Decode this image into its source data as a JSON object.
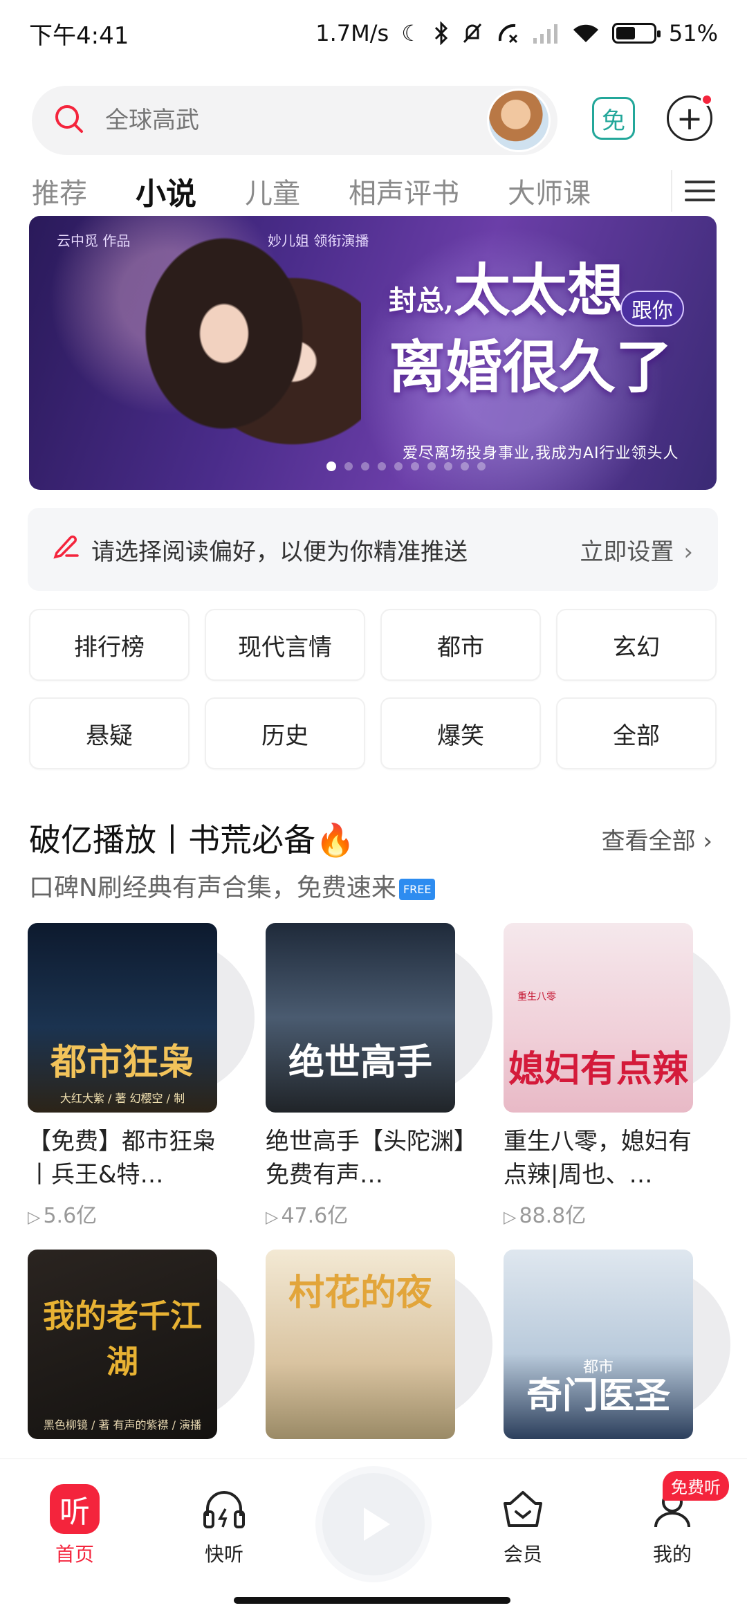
{
  "status": {
    "time": "下午4:41",
    "speed": "1.7M/s",
    "battery": "51%",
    "battery_level": 0.51
  },
  "search": {
    "placeholder": "全球高武"
  },
  "header": {
    "free_label": "免"
  },
  "tabs": [
    {
      "label": "推荐"
    },
    {
      "label": "小说"
    },
    {
      "label": "儿童"
    },
    {
      "label": "相声评书"
    },
    {
      "label": "大师课"
    }
  ],
  "banner": {
    "author": "云中觅 作品",
    "reader": "妙儿姐 领衔演播",
    "title_small": "封总,",
    "title_line1": "太太想",
    "title_line2": "离婚很久了",
    "badge": "跟你",
    "subtitle": "爱尽离场投身事业,我成为AI行业领头人"
  },
  "preference": {
    "text": "请选择阅读偏好，以便为你精准推送",
    "action": "立即设置"
  },
  "categories": [
    "排行榜",
    "现代言情",
    "都市",
    "玄幻",
    "悬疑",
    "历史",
    "爆笑",
    "全部"
  ],
  "section": {
    "title": "破亿播放丨书荒必备🔥",
    "more": "查看全部",
    "subtitle": "口碑N刷经典有声合集，免费速来",
    "free_tag": "FREE"
  },
  "books": [
    {
      "cover_title": "都市狂枭",
      "cover_meta": "大红大紫 / 著  幻樱空 / 制",
      "title": "【免费】都市狂枭丨兵王&特…",
      "plays": "5.6亿"
    },
    {
      "cover_title": "绝世高手",
      "cover_meta": "",
      "title": "绝世高手【头陀渊】免费有声…",
      "plays": "47.6亿"
    },
    {
      "cover_title": "媳妇有点辣",
      "cover_meta": "重生八零",
      "title": "重生八零，媳妇有点辣|周也、…",
      "plays": "88.8亿"
    },
    {
      "cover_title": "我的老千江湖",
      "cover_meta": "黑色柳镜 / 著  有声的紫襟 / 演播",
      "title": "",
      "plays": ""
    },
    {
      "cover_title": "村花的夜",
      "cover_meta": "",
      "title": "",
      "plays": ""
    },
    {
      "cover_title": "奇门医圣",
      "cover_meta": "都市",
      "title": "",
      "plays": ""
    }
  ],
  "nav": {
    "home": "首页",
    "home_icon": "听",
    "quick": "快听",
    "vip": "会员",
    "mine": "我的",
    "free_badge": "免费听"
  }
}
